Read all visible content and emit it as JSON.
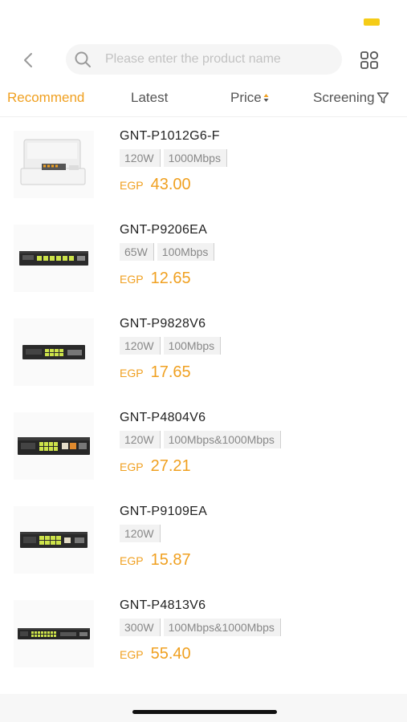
{
  "search": {
    "placeholder": "Please enter the product name"
  },
  "tabs": [
    {
      "label": "Recommend",
      "active": true
    },
    {
      "label": "Latest",
      "active": false
    },
    {
      "label": "Price",
      "active": false,
      "icon": "sort-arrows-icon"
    },
    {
      "label": "Screening",
      "active": false,
      "icon": "filter-icon"
    }
  ],
  "products": [
    {
      "name": "GNT-P1012G6-F",
      "tags": [
        "120W",
        "1000Mbps"
      ],
      "currency": "EGP",
      "price": "43.00",
      "image": "white-outdoor-switch"
    },
    {
      "name": "GNT-P9206EA",
      "tags": [
        "65W",
        "100Mbps"
      ],
      "currency": "EGP",
      "price": "12.65",
      "image": "black-switch"
    },
    {
      "name": "GNT-P9828V6",
      "tags": [
        "120W",
        "100Mbps"
      ],
      "currency": "EGP",
      "price": "17.65",
      "image": "black-switch"
    },
    {
      "name": "GNT-P4804V6",
      "tags": [
        "120W",
        "100Mbps&1000Mbps"
      ],
      "currency": "EGP",
      "price": "27.21",
      "image": "black-switch"
    },
    {
      "name": "GNT-P9109EA",
      "tags": [
        "120W"
      ],
      "currency": "EGP",
      "price": "15.87",
      "image": "black-switch"
    },
    {
      "name": "GNT-P4813V6",
      "tags": [
        "300W",
        "100Mbps&1000Mbps"
      ],
      "currency": "EGP",
      "price": "55.40",
      "image": "black-rack-switch"
    }
  ],
  "colors": {
    "accent": "#f0a020",
    "status_battery": "#f5cc17",
    "tag_bg": "#f2f2f2"
  }
}
